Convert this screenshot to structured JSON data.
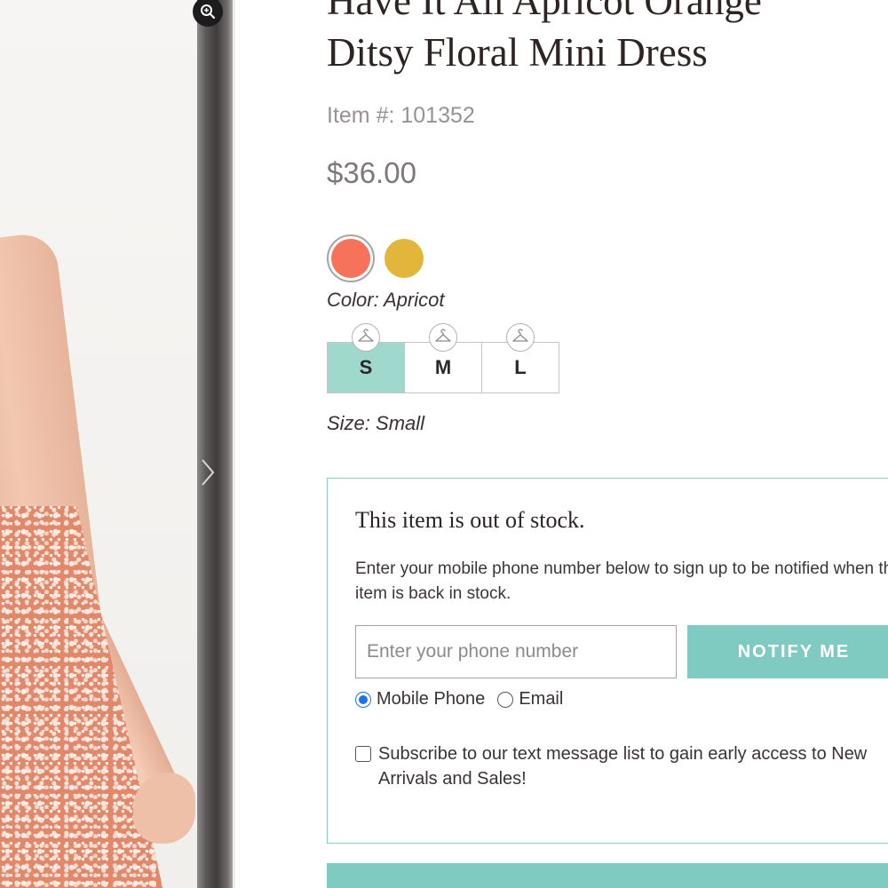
{
  "product": {
    "title_line1": "Have It All Apricot Orange",
    "title_line2": "Ditsy Floral Mini Dress",
    "item_number": "Item #: 101352",
    "price": "$36.00"
  },
  "colors": {
    "options": [
      {
        "name": "Apricot",
        "hex": "#f7725a",
        "selected": true
      },
      {
        "name": "Mustard",
        "hex": "#e2b63b",
        "selected": false
      }
    ],
    "label": "Color: Apricot"
  },
  "sizes": {
    "options": [
      "S",
      "M",
      "L"
    ],
    "selected": "S",
    "label": "Size: Small"
  },
  "stock_notice": {
    "title": "This item is out of stock.",
    "description": "Enter your mobile phone number below to sign up to be notified when this item is back in stock.",
    "phone_placeholder": "Enter your phone number",
    "notify_button": "NOTIFY ME",
    "contact_options": [
      {
        "label": "Mobile Phone",
        "checked": true
      },
      {
        "label": "Email",
        "checked": false
      }
    ],
    "subscribe_text": "Subscribe to our text message list to gain early access to New Arrivals and Sales!"
  },
  "icons": {
    "zoom": "zoom-icon",
    "next": "chevron-right-icon",
    "hanger": "hanger-icon"
  },
  "theme": {
    "accent": "#7fcbc1",
    "size_selected": "#9fd8cc",
    "box_border": "#8ccfc2"
  }
}
